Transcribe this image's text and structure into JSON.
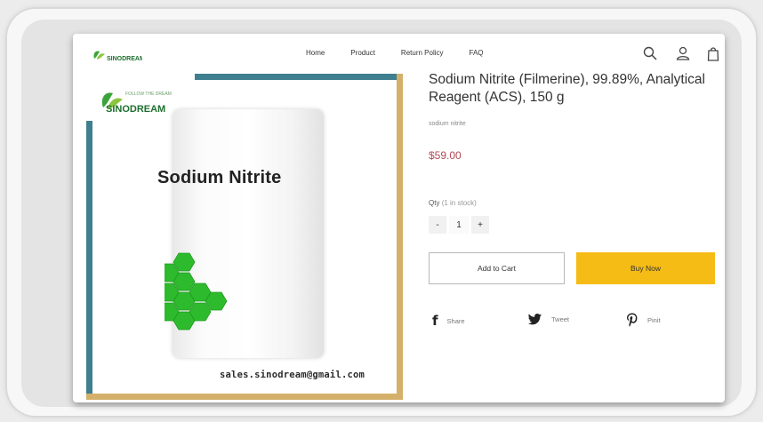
{
  "header": {
    "logo_alt": "SINODREAM",
    "nav": [
      "Home",
      "Product",
      "Return Policy",
      "FAQ"
    ],
    "icons": [
      "search-icon",
      "account-icon",
      "cart-icon"
    ]
  },
  "product_image": {
    "brand": "SINODREAM",
    "brand_tagline": "FOLLOW THE DREAM",
    "packet_label": "Sodium Nitrite",
    "email": "sales.sinodream@gmail.com"
  },
  "product": {
    "title": "Sodium Nitrite (Filmerine), 99.89%, Analytical Reagent (ACS), 150 g",
    "subtitle": "sodium nitrite",
    "price": "$59.00",
    "qty_label": "Qty",
    "stock_text": "(1 in stock)",
    "qty_minus": "-",
    "qty_value": "1",
    "qty_plus": "+",
    "add_to_cart": "Add to Cart",
    "buy_now": "Buy Now"
  },
  "share": [
    {
      "icon": "facebook-icon",
      "glyph": "f",
      "label": "Share"
    },
    {
      "icon": "twitter-icon",
      "glyph": "🐦",
      "label": "Tweet"
    },
    {
      "icon": "pinterest-icon",
      "glyph": "P",
      "label": "Pinit"
    }
  ],
  "colors": {
    "accent_teal": "#3f7f8f",
    "accent_gold": "#d4b06a",
    "buy_button": "#f5bc16",
    "price": "#b24a56",
    "hex_green": "#2dbb2d"
  }
}
